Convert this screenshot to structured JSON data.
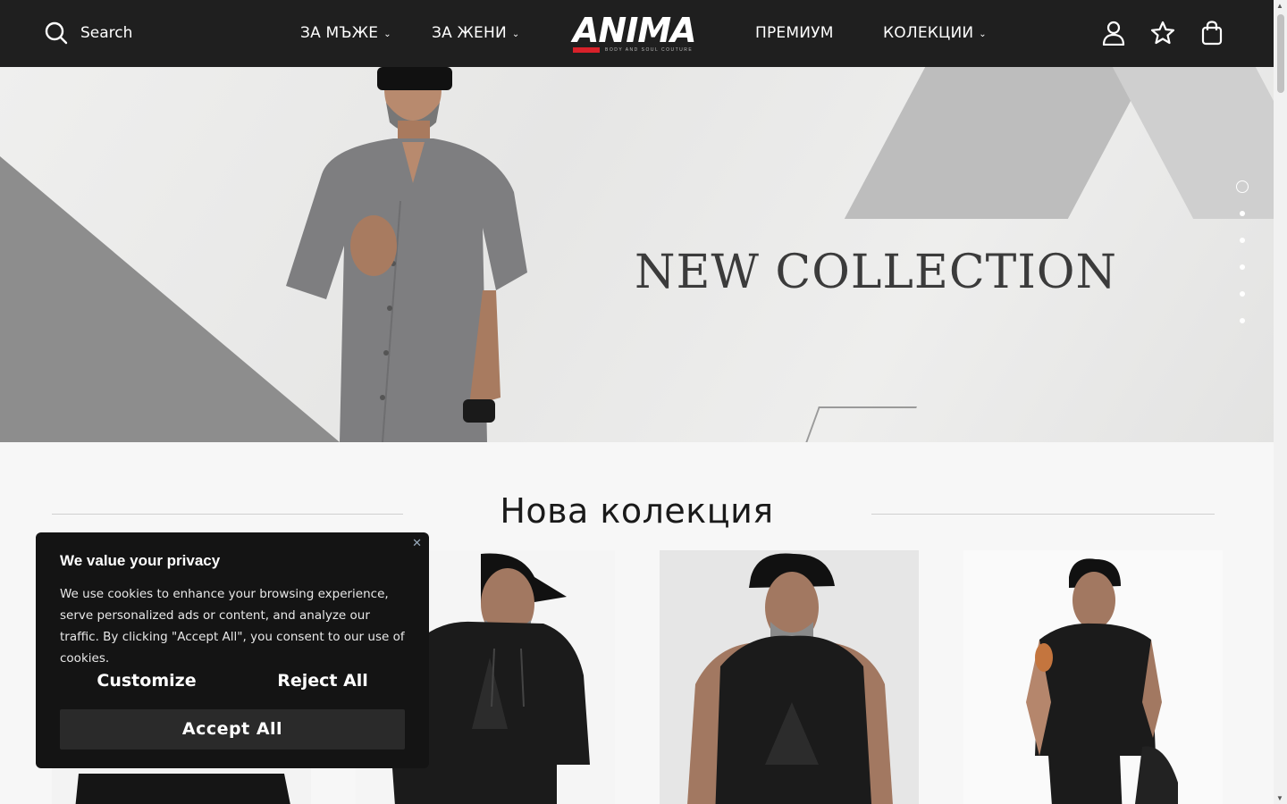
{
  "header": {
    "search_label": "Search",
    "nav": [
      {
        "label": "ЗА МЪЖЕ",
        "has_dropdown": true
      },
      {
        "label": "ЗА ЖЕНИ",
        "has_dropdown": true
      },
      {
        "label": "ПРЕМИУМ",
        "has_dropdown": false
      },
      {
        "label": "КОЛЕКЦИИ",
        "has_dropdown": true
      }
    ],
    "logo_text": "ANIMA",
    "logo_tagline": "BODY AND SOUL COUTURE",
    "icons": [
      "account-icon",
      "wishlist-star-icon",
      "shopping-bag-icon"
    ]
  },
  "hero": {
    "title": "NEW COLLECTION",
    "slide_count": 6,
    "active_slide": 1
  },
  "section": {
    "title": "Нова колекция"
  },
  "cookie_banner": {
    "title": "We value your privacy",
    "body": "We use cookies to enhance your browsing experience, serve personalized ads or content, and analyze our traffic. By clicking \"Accept All\", you consent to our use of cookies.",
    "customize_label": "Customize",
    "reject_label": "Reject All",
    "accept_label": "Accept All"
  },
  "colors": {
    "header_bg": "#1f1f1f",
    "brand_red": "#d8212a",
    "cookie_bg": "#141414"
  }
}
